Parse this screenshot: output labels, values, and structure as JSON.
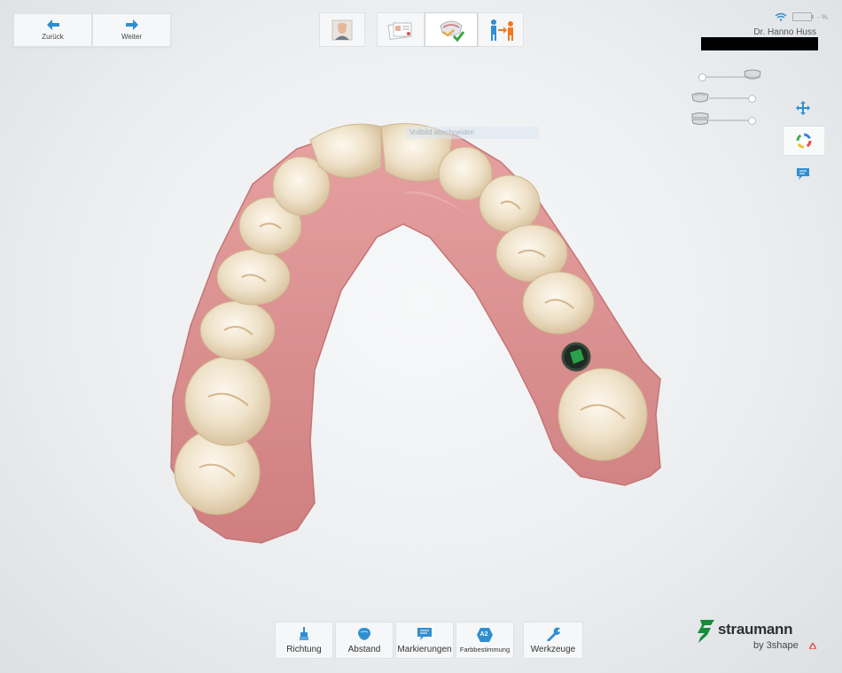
{
  "nav": {
    "back_label": "Zurück",
    "next_label": "Weiter"
  },
  "workflow": {
    "steps": [
      {
        "icon": "patient-photo-icon"
      },
      {
        "icon": "order-form-icon"
      },
      {
        "icon": "scan-check-icon",
        "active": true
      },
      {
        "icon": "send-lab-icon"
      }
    ]
  },
  "user": {
    "name": "Dr. Hanno Huss",
    "battery_label": "- %"
  },
  "scan": {
    "caption": "Vollbild abschneiden"
  },
  "toolbar": {
    "items": [
      {
        "label": "Richtung",
        "icon": "brush-icon"
      },
      {
        "label": "Abstand",
        "icon": "tooth-icon"
      },
      {
        "label": "Markierungen",
        "icon": "annotation-icon"
      },
      {
        "label": "Farbbestimmung",
        "icon": "shade-a2-icon",
        "badge": "A2"
      },
      {
        "label": "Werkzeuge",
        "icon": "wrench-icon"
      }
    ]
  },
  "side_tools": [
    {
      "icon": "move-arrows-icon"
    },
    {
      "icon": "color-wheel-icon"
    },
    {
      "icon": "comment-icon"
    }
  ],
  "logo": {
    "brand": "straumann",
    "sub": "by 3shape"
  },
  "colors": {
    "accent": "#2f8fd0",
    "gum": "#d98c8c",
    "tooth": "#f1e6cf",
    "logo_green": "#1a8a3b"
  }
}
